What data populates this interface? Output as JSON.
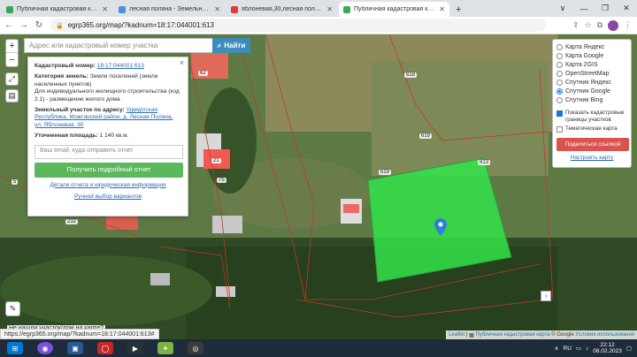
{
  "browser": {
    "tabs": [
      {
        "label": "Публичная кадастровая карта",
        "favicon_color": "#3aa757",
        "active": false
      },
      {
        "label": "лесная поляна - Земельные уч...",
        "favicon_color": "#4a90d9",
        "active": false
      },
      {
        "label": "яблоневая,30,лесная поляна к...",
        "favicon_color": "#e53935",
        "active": false
      },
      {
        "label": "Публичная кадастровая карта",
        "favicon_color": "#3aa757",
        "active": true
      }
    ],
    "new_tab": "+",
    "window_controls": [
      "∨",
      "—",
      "❐",
      "✕"
    ],
    "url": "egrp365.org/map/?kadnum=18:17:044001:613",
    "profile_initial": "З"
  },
  "map": {
    "search": {
      "placeholder": "Адрес или кадастровый номер участка",
      "button_label": "Найти"
    },
    "zoom": {
      "in": "+",
      "out": "−"
    },
    "parcel_labels": [
      "618",
      "619",
      "619",
      "613",
      "62",
      "5",
      "21",
      "75",
      "232"
    ],
    "info": {
      "cadastral_label": "Кадастровый номер:",
      "cadastral_value": "18:17:044001:613",
      "category_label": "Категория земель:",
      "category_value": "Земли поселений (земли населенных пунктов)",
      "use_value": "Для индивидуального жилищного строительства (код 2.1) - размещение жилого дома",
      "address_label": "Земельный участок по адресу:",
      "address_value": "Удмуртская Республика, Можгинский район, д. Лесная Поляна, ул. Яблоневая, 30",
      "area_label": "Уточненная площадь:",
      "area_value": "1 140 кв.м.",
      "email_placeholder": "Ваш email, куда отправить отчет",
      "report_button": "Получить подробный отчет",
      "details_link": "Детали отчета и юридическая информация",
      "manual_link": "Ручной выбор вариантов",
      "close": "×"
    },
    "layers": {
      "options": [
        {
          "label": "Карта Яндекс",
          "selected": false
        },
        {
          "label": "Карта Google",
          "selected": false
        },
        {
          "label": "Карта 2GIS",
          "selected": false
        },
        {
          "label": "OpenStreetMap",
          "selected": false
        },
        {
          "label": "Спутник Яндекс",
          "selected": false
        },
        {
          "label": "Спутник Google",
          "selected": true
        },
        {
          "label": "Спутник Bing",
          "selected": false
        }
      ],
      "show_borders_label": "Показать кадастровые границы участков",
      "thematic_label": "Тематическая карта",
      "share_button": "Поделиться ссылкой",
      "settings_link": "Настроить карту"
    },
    "not_found_text": "Не нашли участок/дом на карте?",
    "status_url": "https://egrp365.org/map/?kadnum=18:17:044001:613#",
    "attribution": {
      "leaflet": "Leaflet",
      "pkk": "Публичная кадастровая карта",
      "google": "© Google",
      "terms": "Условия использования"
    }
  },
  "taskbar": {
    "lang": "RU",
    "time": "22:12",
    "date": "08.02.2023"
  },
  "colors": {
    "selected_parcel": "#33e34a",
    "parcel_border": "#c0392b",
    "accent_blue": "#3c8dbc",
    "report_green": "#5cb85c",
    "share_red": "#d9534f"
  }
}
